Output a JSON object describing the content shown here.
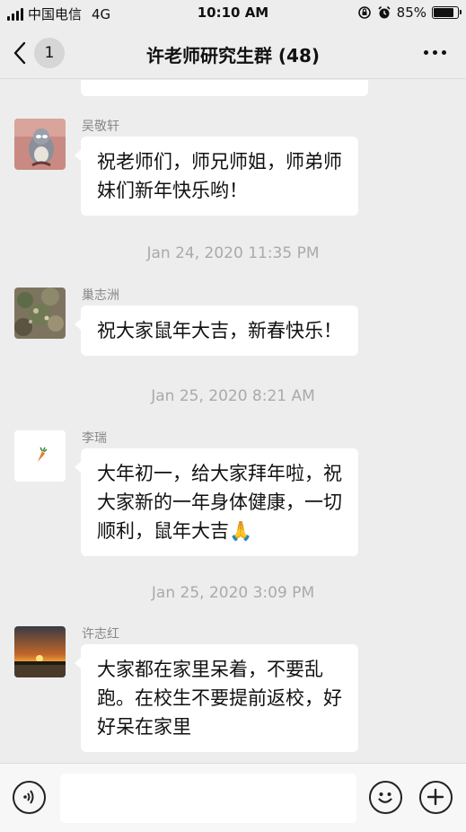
{
  "status_bar": {
    "carrier": "中国电信",
    "network": "4G",
    "time": "10:10 AM",
    "battery_percent": "85%",
    "battery_level": 0.85
  },
  "nav": {
    "unread_count": "1",
    "title": "许老师研究生群 (48)"
  },
  "messages": [
    {
      "sender": "吴敬轩",
      "lines": [
        "祝老师们，师兄师姐，师弟师",
        "妹们新年快乐哟！"
      ],
      "avatar": "cartoon-cat-avatar"
    },
    {
      "sender": "巢志洲",
      "lines": [
        "祝大家鼠年大吉，新春快乐！"
      ],
      "avatar": "plant-photo-avatar"
    },
    {
      "sender": "李瑞",
      "lines": [
        "大年初一，给大家拜年啦，祝",
        "大家新的一年身体健康，一切",
        "顺利，鼠年大吉"
      ],
      "emoji": "🙏",
      "avatar": "carrot-avatar"
    },
    {
      "sender": "许志红",
      "lines": [
        "大家都在家里呆着，不要乱",
        "跑。在校生不要提前返校，好",
        "好呆在家里"
      ],
      "avatar": "sunset-photo-avatar"
    }
  ],
  "timestamps": [
    "Jan 24, 2020 11:35 PM",
    "Jan 25, 2020 8:21 AM",
    "Jan 25, 2020 3:09 PM"
  ],
  "input_bar": {
    "text_value": "",
    "voice_icon": "voice-icon",
    "emoji_icon": "emoji-icon",
    "add_icon": "plus-icon"
  },
  "colors": {
    "background": "#ededed",
    "bubble": "#ffffff",
    "timestamp_text": "#aaaaaa",
    "sender_text": "#888888"
  }
}
